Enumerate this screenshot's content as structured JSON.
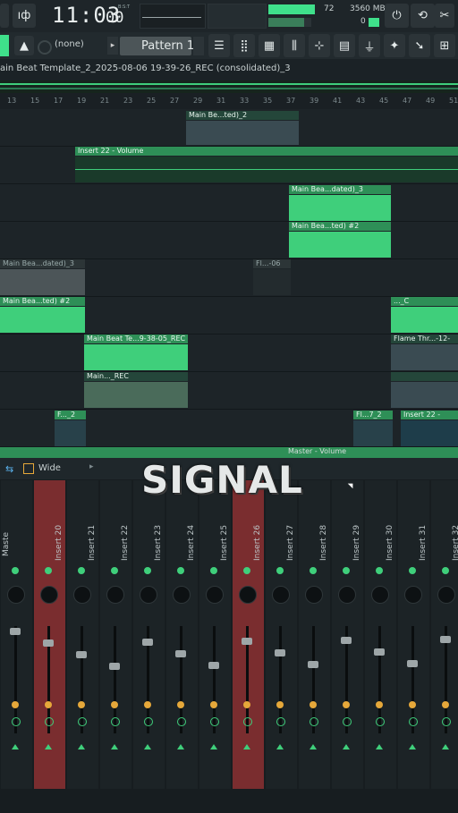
{
  "topbar": {
    "time_main": "11:03",
    "time_ms": "00",
    "time_unit": "B:S:T",
    "tempo_value": "72",
    "memory": "3560 MB",
    "memory_sub": "0"
  },
  "toolbar": {
    "preset": "(none)",
    "pattern": "Pattern 1"
  },
  "title": "ain Beat Template_2_2025-08-06 19-39-26_REC (consolidated)_3",
  "ruler": [
    "13",
    "15",
    "17",
    "19",
    "21",
    "23",
    "25",
    "27",
    "29",
    "31",
    "33",
    "35",
    "37",
    "39",
    "41",
    "43",
    "45",
    "47",
    "49",
    "51"
  ],
  "playlist": {
    "clips": [
      {
        "label": "Main Be...ted)_2"
      },
      {
        "label": "Insert 22 - Volume"
      },
      {
        "label": "Main Bea...dated)_3"
      },
      {
        "label": "Main Bea...ted) #2"
      },
      {
        "label": "Main Bea...dated)_3"
      },
      {
        "label": "Fl...-06"
      },
      {
        "label": "Main Bea...ted) #2"
      },
      {
        "label": "..._C"
      },
      {
        "label": "Main Beat Te...9-38-05_REC"
      },
      {
        "label": "Flame Thr...-12-"
      },
      {
        "label": "Main..._REC"
      },
      {
        "label": "F..._2"
      },
      {
        "label": "Fl...7_2"
      },
      {
        "label": "Insert 22 -"
      },
      {
        "label": "Master - Volume"
      }
    ]
  },
  "mixer": {
    "view_mode": "Wide",
    "channel_numbers": [
      "M",
      "",
      "20",
      "21",
      "22",
      "23",
      "24",
      "25",
      "26",
      "27",
      "28",
      "29",
      "30",
      "31",
      "3"
    ],
    "channel_names": [
      "Insert 20",
      "Insert 21",
      "Insert 22",
      "Insert 23",
      "Insert 24",
      "Insert 25",
      "Insert 26",
      "Insert 27",
      "Insert 28",
      "Insert 29",
      "Insert 30",
      "Insert 31",
      "Insert 32"
    ],
    "master_label": "Maste"
  },
  "overlay": {
    "watermark": "SIGNAL"
  }
}
